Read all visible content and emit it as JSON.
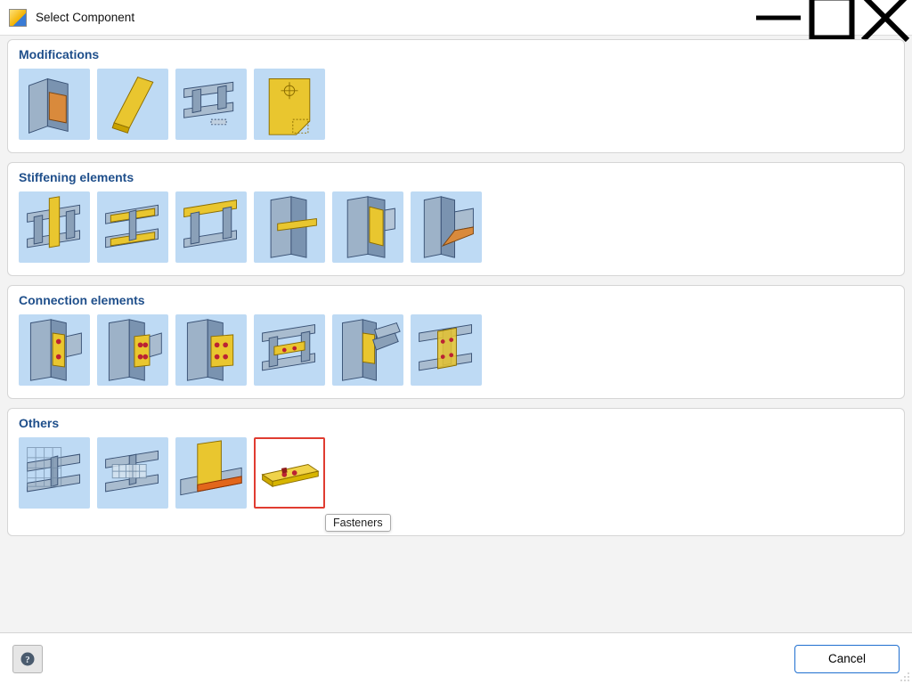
{
  "window": {
    "title": "Select Component"
  },
  "sections": {
    "modifications": {
      "title": "Modifications",
      "items": [
        {
          "name": "opening-rectangular"
        },
        {
          "name": "plate"
        },
        {
          "name": "cope-notch"
        },
        {
          "name": "hole-drill"
        }
      ]
    },
    "stiffening": {
      "title": "Stiffening elements",
      "items": [
        {
          "name": "rib-stiffener"
        },
        {
          "name": "widener-plate"
        },
        {
          "name": "cap-plate-top"
        },
        {
          "name": "cap-plate-between"
        },
        {
          "name": "doubler-plate"
        },
        {
          "name": "haunch"
        }
      ]
    },
    "connection": {
      "title": "Connection elements",
      "items": [
        {
          "name": "end-plate"
        },
        {
          "name": "fin-plate"
        },
        {
          "name": "cleat-angle"
        },
        {
          "name": "seat-plate"
        },
        {
          "name": "splice-welded"
        },
        {
          "name": "cover-plate"
        }
      ]
    },
    "others": {
      "title": "Others",
      "items": [
        {
          "name": "grid-work-plane"
        },
        {
          "name": "contact-surfaces"
        },
        {
          "name": "weld"
        },
        {
          "name": "fasteners",
          "selected": true
        }
      ]
    }
  },
  "tooltip": {
    "text": "Fasteners"
  },
  "footer": {
    "cancel_label": "Cancel"
  }
}
